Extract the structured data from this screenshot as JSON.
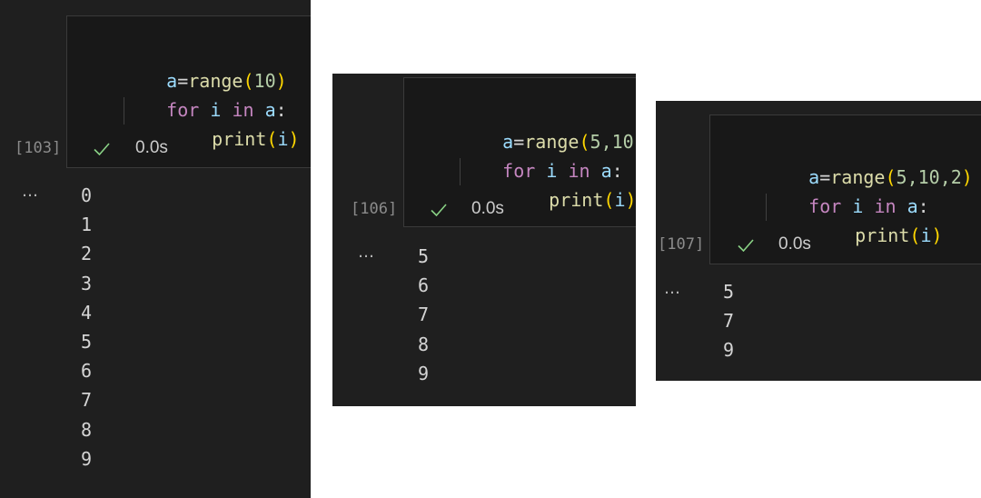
{
  "colors": {
    "panel_bg": "#1f1f1f",
    "code_bg": "#181818",
    "variable": "#9cdcfe",
    "function": "#dcdcaa",
    "keyword": "#c586c0",
    "number": "#b5cea8",
    "bracket": "#ffd700",
    "success_check": "#89d185"
  },
  "cells": [
    {
      "execution_count": "[103]",
      "code": {
        "line1": {
          "var": "a",
          "op": "=",
          "fn": "range",
          "open": "(",
          "args": "10",
          "close": ")"
        },
        "line2": {
          "kw_for": "for",
          "iter": "i",
          "kw_in": "in",
          "target": "a",
          "colon": ":"
        },
        "line3": {
          "fn": "print",
          "open": "(",
          "arg": "i",
          "close": ")"
        }
      },
      "status": {
        "icon": "check-icon",
        "time": "0.0s"
      },
      "output_marker": "…",
      "output": [
        "0",
        "1",
        "2",
        "3",
        "4",
        "5",
        "6",
        "7",
        "8",
        "9"
      ]
    },
    {
      "execution_count": "[106]",
      "code": {
        "line1": {
          "var": "a",
          "op": "=",
          "fn": "range",
          "open": "(",
          "args": "5,10",
          "close": ")"
        },
        "line2": {
          "kw_for": "for",
          "iter": "i",
          "kw_in": "in",
          "target": "a",
          "colon": ":"
        },
        "line3": {
          "fn": "print",
          "open": "(",
          "arg": "i",
          "close": ")"
        }
      },
      "status": {
        "icon": "check-icon",
        "time": "0.0s"
      },
      "output_marker": "…",
      "output": [
        "5",
        "6",
        "7",
        "8",
        "9"
      ]
    },
    {
      "execution_count": "[107]",
      "code": {
        "line1": {
          "var": "a",
          "op": "=",
          "fn": "range",
          "open": "(",
          "args": "5,10,2",
          "close": ")"
        },
        "line2": {
          "kw_for": "for",
          "iter": "i",
          "kw_in": "in",
          "target": "a",
          "colon": ":"
        },
        "line3": {
          "fn": "print",
          "open": "(",
          "arg": "i",
          "close": ")"
        }
      },
      "status": {
        "icon": "check-icon",
        "time": "0.0s"
      },
      "output_marker": "…",
      "output": [
        "5",
        "7",
        "9"
      ]
    }
  ]
}
